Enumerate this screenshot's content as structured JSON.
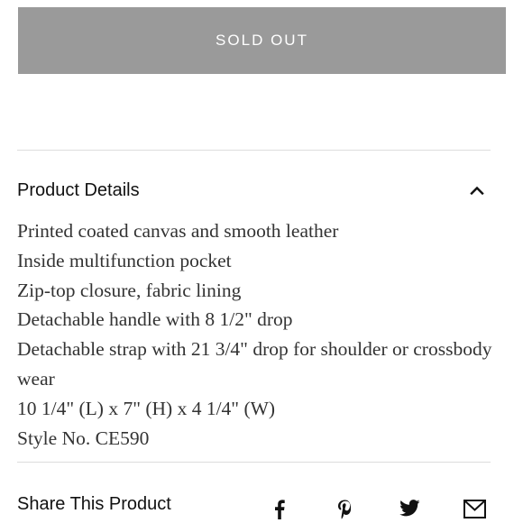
{
  "buy_button": {
    "label": "SOLD OUT"
  },
  "product_details": {
    "title": "Product Details",
    "expanded": true,
    "toggle_icon": "chevron-up-icon",
    "items": [
      "Printed coated canvas and smooth leather",
      "Inside multifunction pocket",
      "Zip-top closure, fabric lining",
      "Detachable handle with 8 1/2\" drop",
      "Detachable strap with 21 3/4\" drop for shoulder or crossbody wear",
      "10 1/4\" (L) x 7\" (H) x 4 1/4\" (W)",
      "Style No. CE590"
    ]
  },
  "share": {
    "title": "Share This Product",
    "icons": [
      "facebook-icon",
      "pinterest-icon",
      "twitter-icon",
      "email-icon"
    ]
  },
  "colors": {
    "button_bg": "#9a9a9a",
    "button_text": "#ffffff",
    "divider": "#dddddd",
    "heading_text": "#111111",
    "body_text": "#333333"
  }
}
